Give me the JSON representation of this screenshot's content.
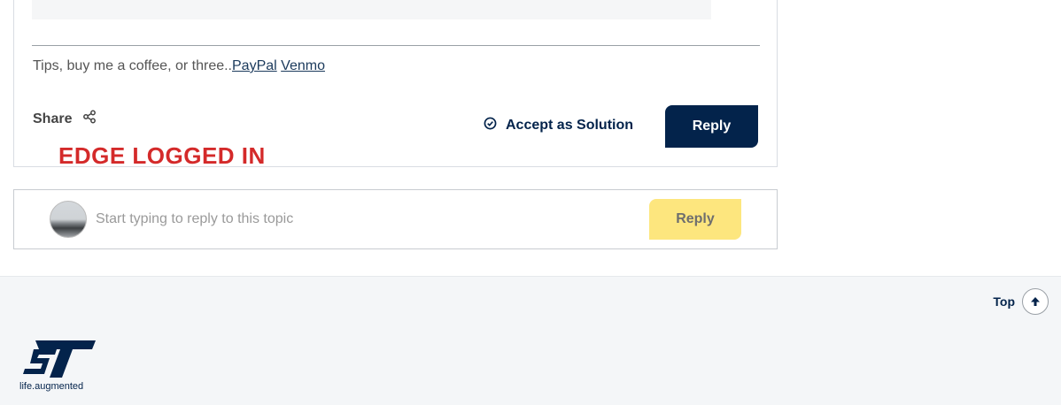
{
  "post": {
    "tips_text": "Tips, buy me a coffee, or three..",
    "paypal_link": "PayPal",
    "venmo_link": "Venmo",
    "share_label": "Share",
    "accept_label": "Accept as Solution",
    "reply_label": "Reply"
  },
  "overlay_label": "EDGE LOGGED IN",
  "reply_box": {
    "placeholder": "Start typing to reply to this topic",
    "reply_label": "Reply"
  },
  "footer": {
    "top_label": "Top",
    "logo_tagline": "life.augmented"
  },
  "colors": {
    "brand_navy": "#03234b",
    "reply_yellow": "#fde67e",
    "overlay_red": "#d42a2a"
  }
}
